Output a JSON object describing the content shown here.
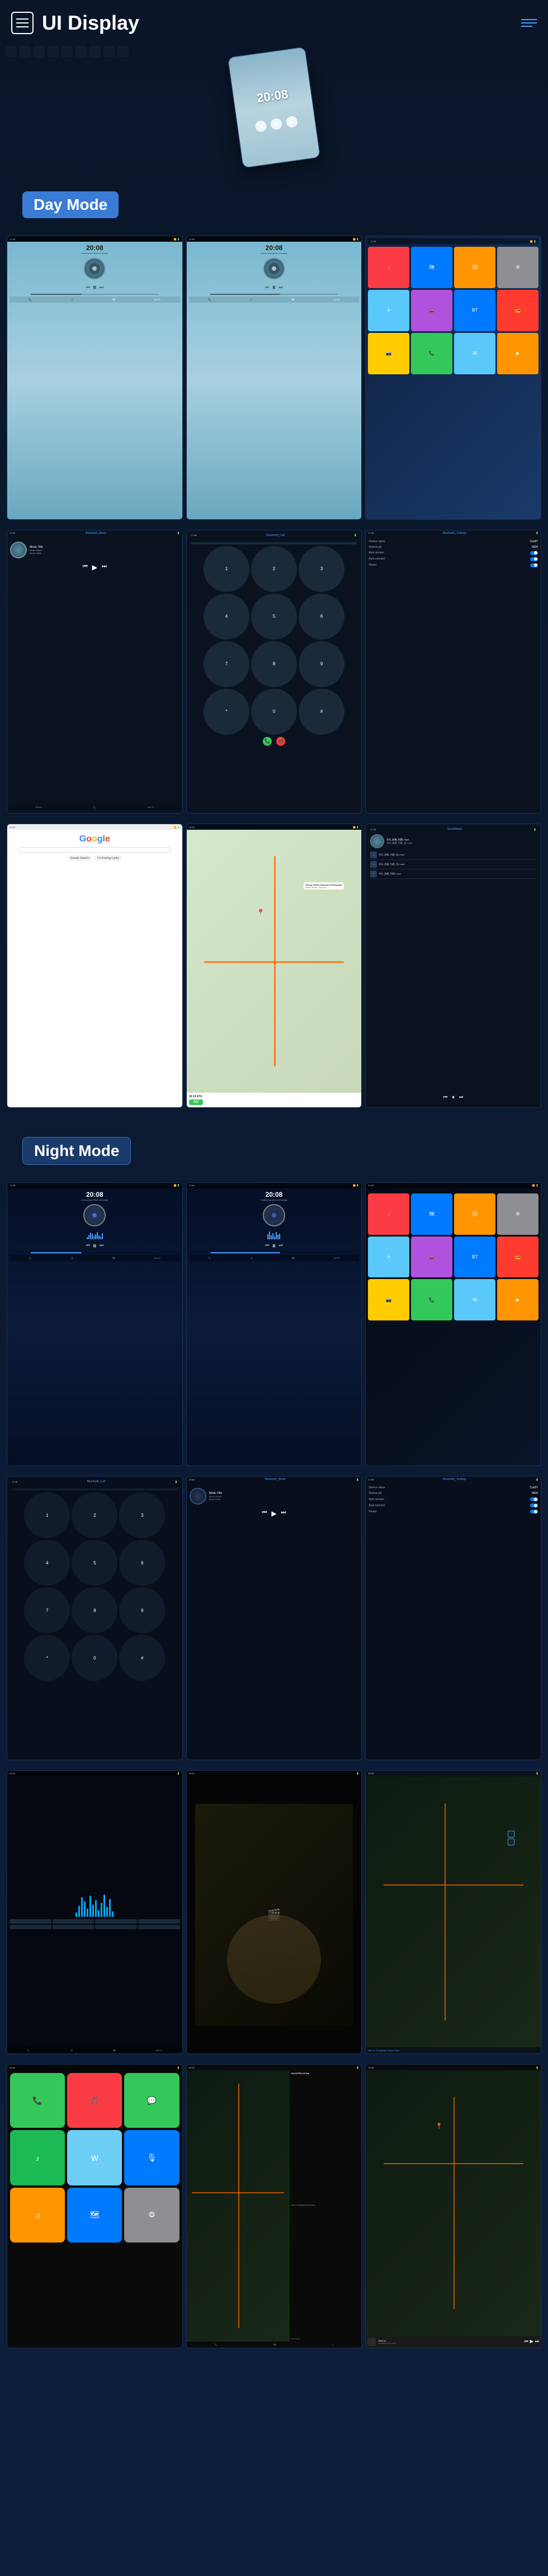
{
  "header": {
    "title": "UI Display",
    "menu_label": "menu",
    "lines_label": "decoration"
  },
  "day_mode": {
    "label": "Day Mode",
    "screens": [
      {
        "id": "day-music-1",
        "type": "music_player_day",
        "time": "20:08",
        "subtitle": "A stunning blend of beauty"
      },
      {
        "id": "day-music-2",
        "type": "music_player_day",
        "time": "20:08",
        "subtitle": "A stunning blend of beauty"
      },
      {
        "id": "day-home",
        "type": "home_screen_day"
      },
      {
        "id": "day-bt-music",
        "type": "bluetooth_music",
        "title": "Bluetooth_Music",
        "track": "Music Title",
        "album": "Music Album",
        "artist": "Music Artist"
      },
      {
        "id": "day-bt-call",
        "type": "bluetooth_call",
        "title": "Bluetooth_Call"
      },
      {
        "id": "day-bt-settings",
        "type": "bluetooth_settings",
        "title": "Bluetooth_Settings",
        "rows": [
          {
            "label": "Device name",
            "value": "CarBT"
          },
          {
            "label": "Device pin",
            "value": "0000"
          },
          {
            "label": "Auto answer",
            "value": "",
            "toggle": "on"
          },
          {
            "label": "Auto connect",
            "value": "",
            "toggle": "on"
          },
          {
            "label": "Power",
            "value": "",
            "toggle": "on"
          }
        ]
      },
      {
        "id": "day-google",
        "type": "google"
      },
      {
        "id": "day-map",
        "type": "map",
        "title": "Sunny Coffee Roasters Restaurant",
        "address": "Midtown Modern, Singapore",
        "eta": "18:15 ETA",
        "go": "GO"
      },
      {
        "id": "day-local-music",
        "type": "local_music",
        "title": "SocialMusic",
        "files": [
          "华乐_经典_列表1.mp3",
          "华乐_经典_列表2.mp3",
          "华乐_经典_列表1.mp3"
        ]
      }
    ]
  },
  "night_mode": {
    "label": "Night Mode",
    "screens": [
      {
        "id": "night-music-1",
        "type": "music_player_night",
        "time": "20:08"
      },
      {
        "id": "night-music-2",
        "type": "music_player_night",
        "time": "20:08"
      },
      {
        "id": "night-home",
        "type": "home_screen_night"
      },
      {
        "id": "night-bt-call",
        "type": "bluetooth_call_night",
        "title": "Bluetooth_Call"
      },
      {
        "id": "night-bt-music",
        "type": "bluetooth_music_night",
        "title": "Bluetooth_Music",
        "track": "Music Title",
        "album": "Music Album",
        "artist": "Music Artist"
      },
      {
        "id": "night-bt-settings",
        "type": "bluetooth_settings_night",
        "title": "Bluetooth_Settings",
        "rows": [
          {
            "label": "Device name",
            "value": "CarBT"
          },
          {
            "label": "Device pin",
            "value": "0000"
          },
          {
            "label": "Auto answer",
            "value": "",
            "toggle": "on"
          },
          {
            "label": "Auto connect",
            "value": "",
            "toggle": "on"
          },
          {
            "label": "Power",
            "value": "",
            "toggle": "on"
          }
        ]
      },
      {
        "id": "night-waves",
        "type": "equalizer_night"
      },
      {
        "id": "night-video",
        "type": "video_night"
      },
      {
        "id": "night-nav",
        "type": "navigation_night"
      },
      {
        "id": "night-carplay-home",
        "type": "carplay_home_night"
      },
      {
        "id": "night-map",
        "type": "map_night",
        "eta": "10:19 ETA 9.0 km",
        "direction": "Start on Sengkang Torque Road",
        "music_label": "Not Playing"
      },
      {
        "id": "night-map2",
        "type": "map2_night"
      }
    ]
  },
  "music_album_label": "Music Album",
  "music_artist_label": "Music Artist"
}
